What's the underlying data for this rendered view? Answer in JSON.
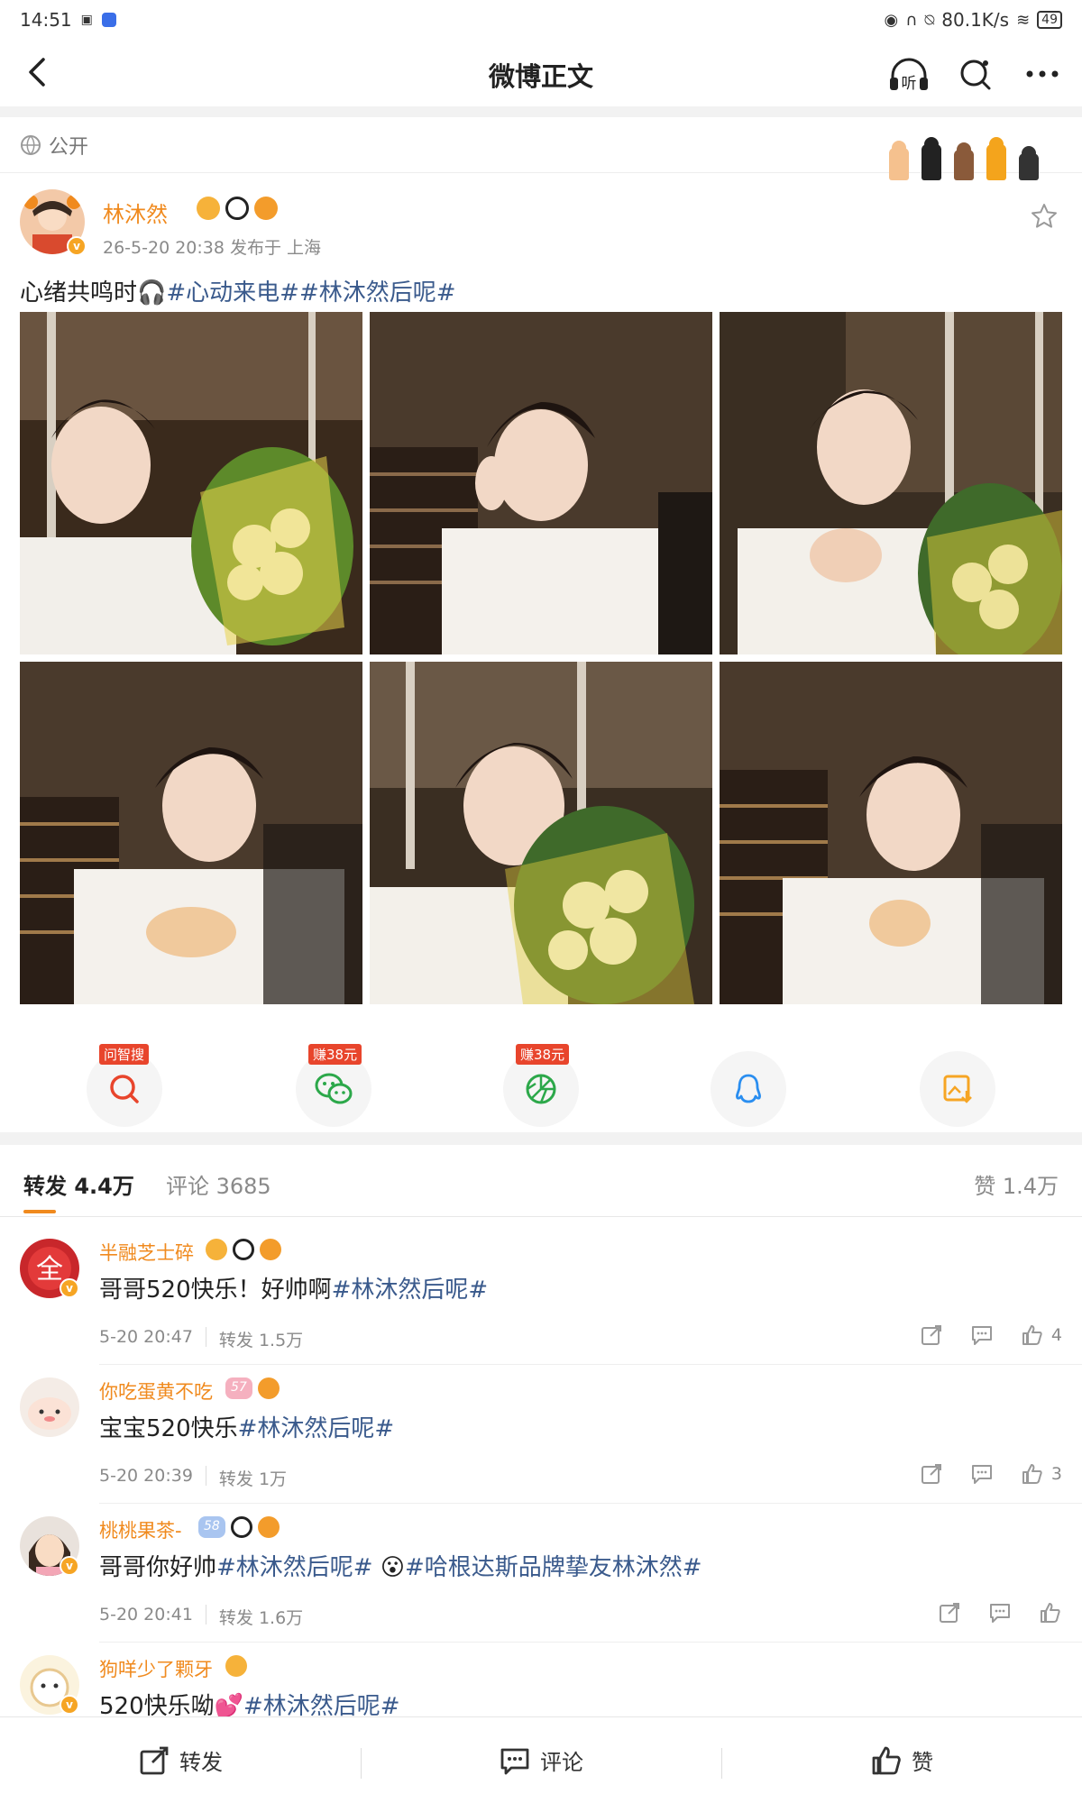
{
  "status_bar": {
    "time": "14:51",
    "network_speed": "80.1K/s",
    "battery": "49"
  },
  "nav": {
    "title": "微博正文",
    "listen_label": "听"
  },
  "visibility": {
    "label": "公开"
  },
  "post": {
    "author": "林沐然",
    "meta": "26-5-20 20:38  发布于 上海",
    "text_plain": "心绪共鸣时",
    "text_topics": "#心动来电##林沐然后呢#",
    "photos": [
      "photo-1",
      "photo-2",
      "photo-3",
      "photo-4",
      "photo-5",
      "photo-6"
    ]
  },
  "share": {
    "items": [
      {
        "name": "search-share",
        "tag": "问智搜",
        "icon": "search-icon"
      },
      {
        "name": "wechat-share",
        "tag": "赚38元",
        "icon": "wechat-icon"
      },
      {
        "name": "moments-share",
        "tag": "赚38元",
        "icon": "moments-icon"
      },
      {
        "name": "qq-share",
        "tag": "",
        "icon": "qq-icon"
      },
      {
        "name": "save-image",
        "tag": "",
        "icon": "save-image-icon"
      }
    ]
  },
  "tabs": {
    "repost": "转发 4.4万",
    "comment": "评论 3685",
    "like": "赞 1.4万"
  },
  "comments": [
    {
      "name": "半融芝士碎",
      "text_plain": "哥哥520快乐！好帅啊",
      "text_topic": "#林沐然后呢#",
      "time": "5-20 20:47",
      "repost": "转发 1.5万",
      "likes": "4",
      "level": ""
    },
    {
      "name": "你吃蛋黄不吃",
      "text_plain": "宝宝520快乐",
      "text_topic": "#林沐然后呢#",
      "time": "5-20 20:39",
      "repost": "转发 1万",
      "likes": "3",
      "level": "57"
    },
    {
      "name": "桃桃果茶-",
      "text_plain": "哥哥你好帅",
      "text_topic": "#林沐然后呢# ",
      "text_topic2": "#哈根达斯品牌挚友林沐然#",
      "time": "5-20 20:41",
      "repost": "转发 1.6万",
      "likes": "",
      "level": "58"
    },
    {
      "name": "狗咩少了颗牙",
      "text_plain": "520快乐呦",
      "text_topic": "#林沐然后呢#",
      "time": "",
      "repost": "",
      "likes": "",
      "level": ""
    }
  ],
  "bottom_bar": {
    "repost": "转发",
    "comment": "评论",
    "like": "赞"
  },
  "colors": {
    "accent": "#f08a1e",
    "topic": "#3a5a8c",
    "tag_red": "#e8452c",
    "verify": "#f6a524"
  }
}
